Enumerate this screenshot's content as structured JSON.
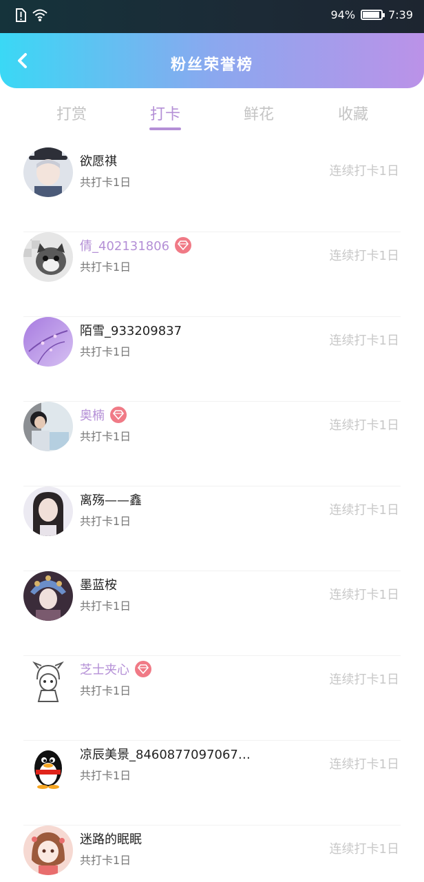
{
  "status_bar": {
    "battery_text": "94%",
    "battery_level": 0.94,
    "time": "7:39",
    "icons": [
      "alert-icon",
      "wifi-icon",
      "battery-icon"
    ]
  },
  "header": {
    "title": "粉丝荣誉榜",
    "back_icon": "chevron-left-icon"
  },
  "tabs": [
    {
      "label": "打赏",
      "active": false
    },
    {
      "label": "打卡",
      "active": true
    },
    {
      "label": "鲜花",
      "active": false
    },
    {
      "label": "收藏",
      "active": false
    }
  ],
  "fans": [
    {
      "name": "欲愿祺",
      "vip": false,
      "total": "共打卡1日",
      "streak": "连续打卡1日",
      "avatar": "avatar-boy-hat"
    },
    {
      "name": "倩_402131806",
      "vip": true,
      "total": "共打卡1日",
      "streak": "连续打卡1日",
      "avatar": "avatar-cat"
    },
    {
      "name": "陌雪_933209837",
      "vip": false,
      "total": "共打卡1日",
      "streak": "连续打卡1日",
      "avatar": "avatar-purple"
    },
    {
      "name": "奥楠",
      "vip": true,
      "total": "共打卡1日",
      "streak": "连续打卡1日",
      "avatar": "avatar-photo"
    },
    {
      "name": "离殇——鑫",
      "vip": false,
      "total": "共打卡1日",
      "streak": "连续打卡1日",
      "avatar": "avatar-girl"
    },
    {
      "name": "墨蓝桉",
      "vip": false,
      "total": "共打卡1日",
      "streak": "连续打卡1日",
      "avatar": "avatar-queen"
    },
    {
      "name": "芝士夹心",
      "vip": true,
      "total": "共打卡1日",
      "streak": "连续打卡1日",
      "avatar": "avatar-sketch"
    },
    {
      "name": "凉辰美景_8460877097067…",
      "vip": false,
      "total": "共打卡1日",
      "streak": "连续打卡1日",
      "avatar": "avatar-penguin"
    },
    {
      "name": "迷路的眠眠",
      "vip": false,
      "total": "共打卡1日",
      "streak": "连续打卡1日",
      "avatar": "avatar-anime-girl"
    }
  ],
  "colors": {
    "accent": "#b48fd6",
    "vip_badge": "#f07a86",
    "header_gradient_start": "#3ad8f5",
    "header_gradient_end": "#bb92e8"
  }
}
